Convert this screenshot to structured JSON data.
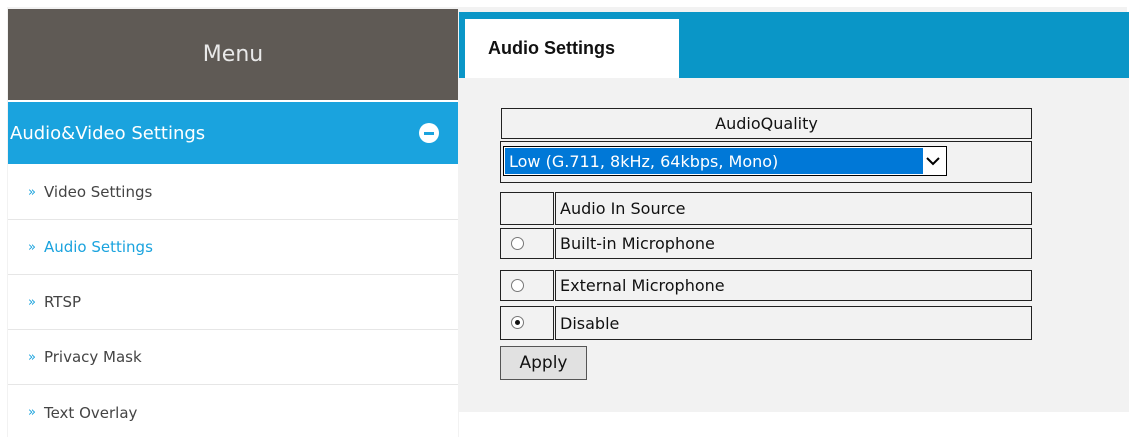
{
  "sidebar": {
    "menu_title": "Menu",
    "section_title": "Audio&Video Settings",
    "items": [
      {
        "label": "Video Settings"
      },
      {
        "label": "Audio Settings"
      },
      {
        "label": "RTSP"
      },
      {
        "label": "Privacy Mask"
      },
      {
        "label": "Text Overlay"
      }
    ],
    "active_item": "Audio Settings",
    "bullet": "»"
  },
  "tab": {
    "label": "Audio Settings"
  },
  "audio_quality": {
    "header": "AudioQuality",
    "selected": "Low (G.711, 8kHz, 64kbps, Mono)"
  },
  "audio_source": {
    "header": "Audio In Source",
    "options": [
      {
        "label": "Built-in Microphone",
        "checked": false
      },
      {
        "label": "External Microphone",
        "checked": false
      },
      {
        "label": "Disable",
        "checked": true
      }
    ]
  },
  "apply_label": "Apply",
  "colors": {
    "accent": "#1aa3de",
    "tabbar": "#0a96c7",
    "menu_header": "#5f5a55",
    "select_highlight": "#0078d7"
  }
}
